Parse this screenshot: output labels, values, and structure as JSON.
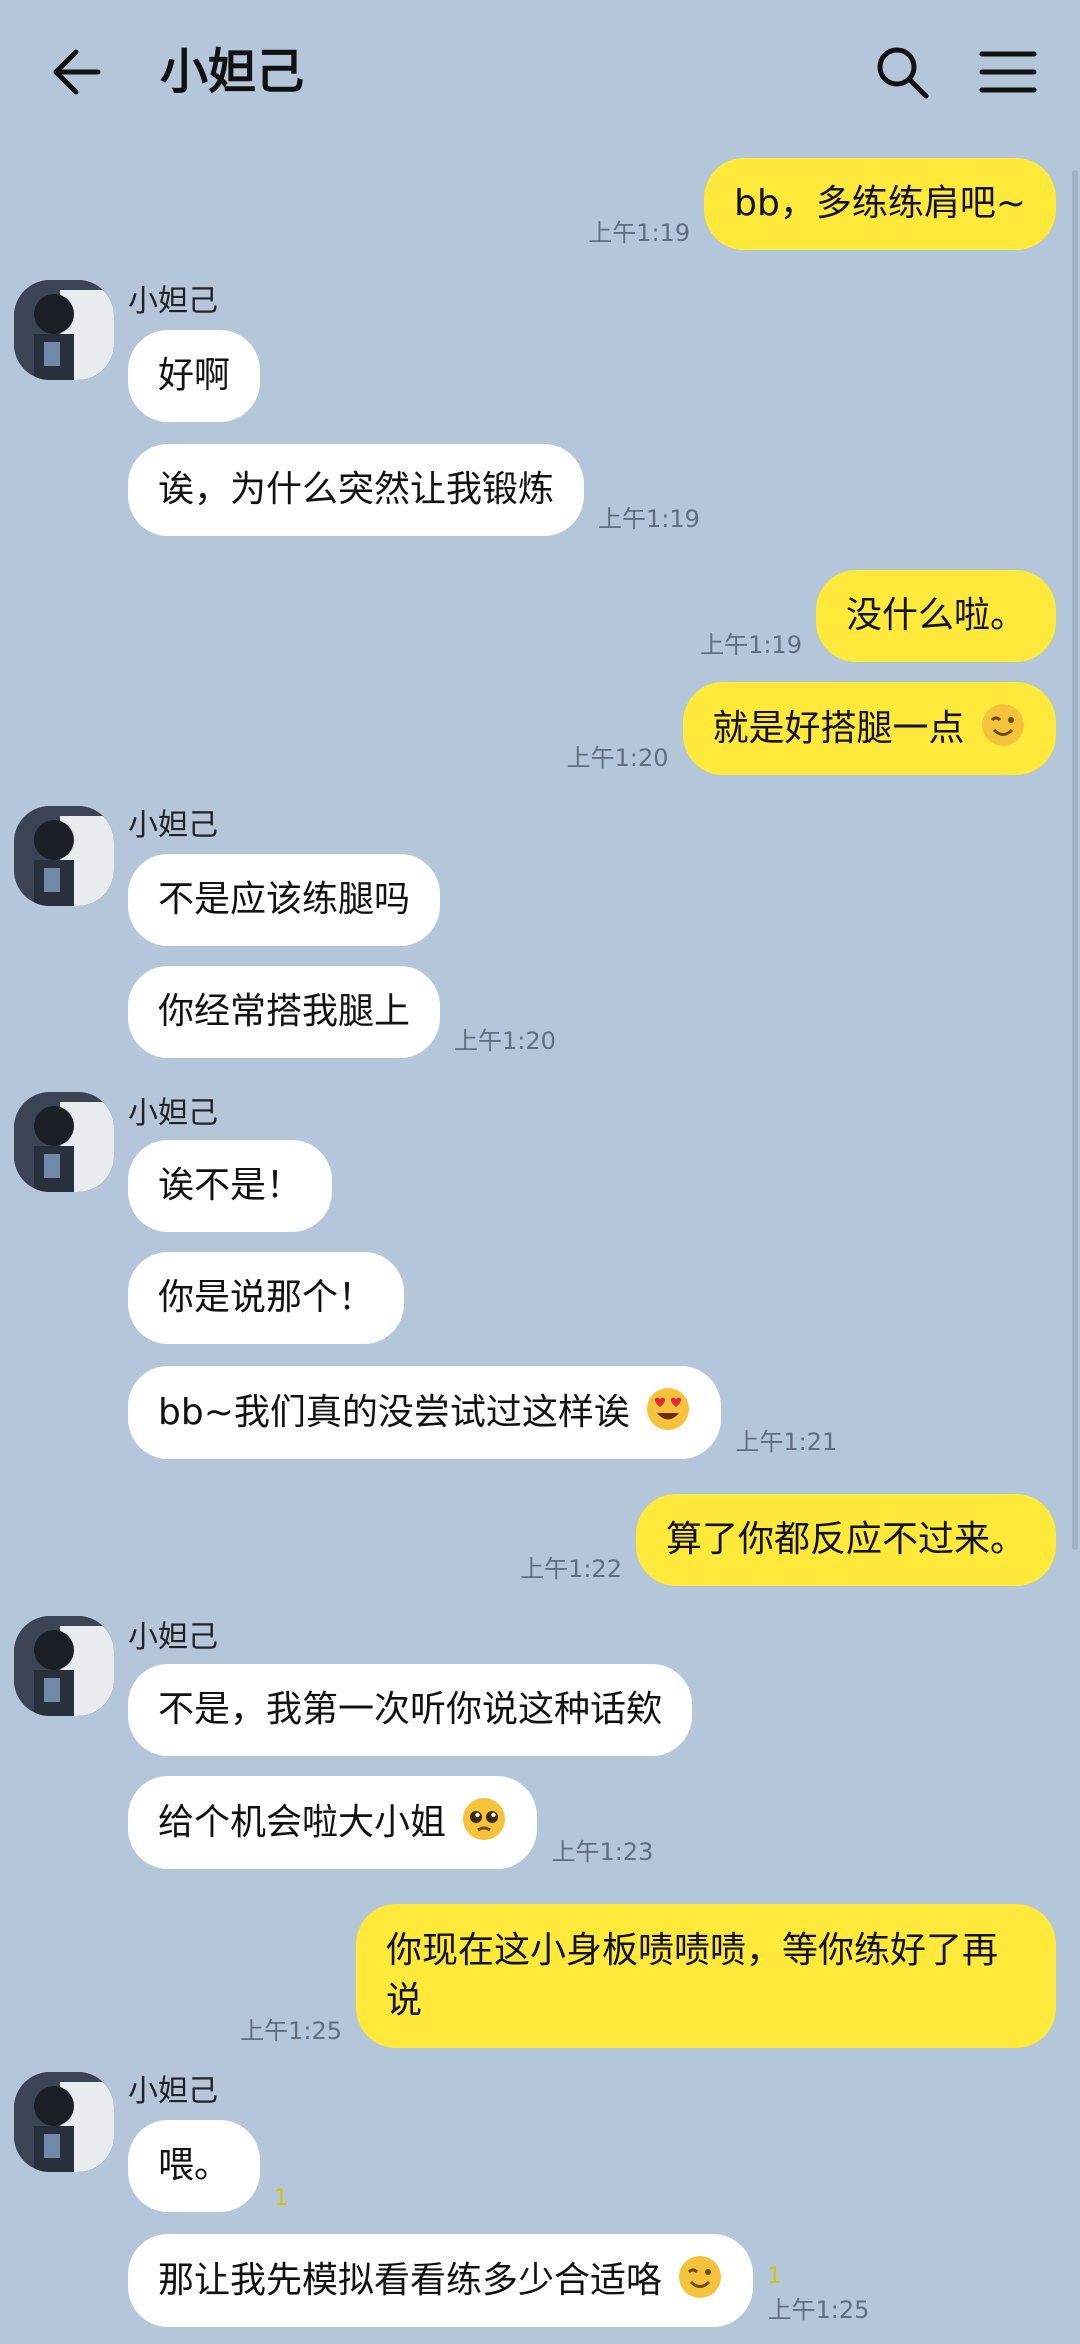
{
  "header": {
    "title": "小妲己"
  },
  "contact_name": "小妲己",
  "messages": {
    "m1": {
      "text": "bb，多练练肩吧~",
      "time": "上午1:19"
    },
    "m2": {
      "text": "好啊"
    },
    "m3": {
      "text": "诶，为什么突然让我锻炼",
      "time": "上午1:19"
    },
    "m4": {
      "text": "没什么啦。",
      "time": "上午1:19"
    },
    "m5": {
      "text": "就是好搭腿一点",
      "time": "上午1:20"
    },
    "m6": {
      "text": "不是应该练腿吗"
    },
    "m7": {
      "text": "你经常搭我腿上",
      "time": "上午1:20"
    },
    "m8": {
      "text": "诶不是！"
    },
    "m9": {
      "text": "你是说那个！"
    },
    "m10": {
      "text": "bb~我们真的没尝试过这样诶",
      "time": "上午1:21"
    },
    "m11": {
      "text": "算了你都反应不过来。",
      "time": "上午1:22"
    },
    "m12": {
      "text": "不是，我第一次听你说这种话欸"
    },
    "m13": {
      "text": "给个机会啦大小姐",
      "time": "上午1:23"
    },
    "m14": {
      "text": "你现在这小身板啧啧啧，等你练好了再说",
      "time": "上午1:25"
    },
    "m15": {
      "text": "喂。",
      "unread": "1"
    },
    "m16": {
      "text": "那让我先模拟看看练多少合适咯",
      "unread": "1",
      "time": "上午1:25"
    }
  },
  "icons": {
    "back": "arrow-left-icon",
    "search": "search-icon",
    "menu": "hamburger-menu-icon",
    "emoji_wink": "wink-emoji",
    "emoji_heart_eyes": "heart-eyes-emoji",
    "emoji_pleading": "pleading-emoji"
  },
  "colors": {
    "background": "#b4c6d9",
    "my_bubble": "#ffe93a",
    "their_bubble": "#ffffff"
  }
}
